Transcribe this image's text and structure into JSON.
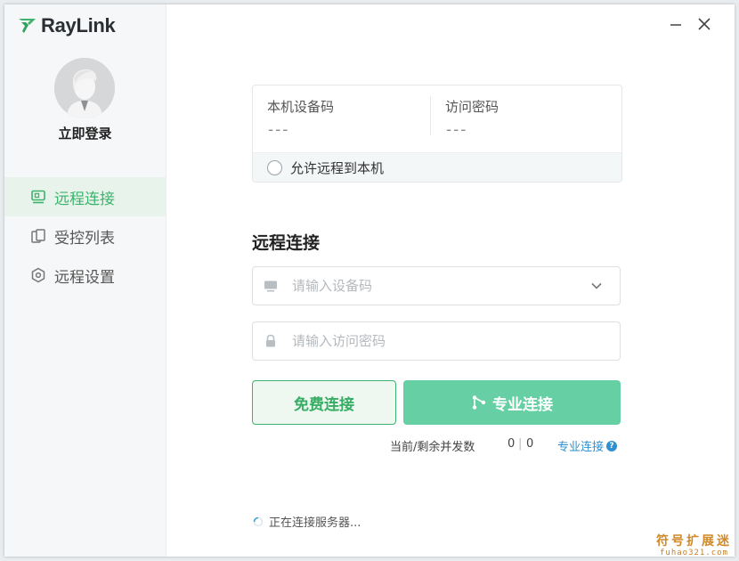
{
  "app": {
    "logo_text": "RayLink"
  },
  "sidebar": {
    "login_label": "立即登录",
    "items": [
      {
        "label": "远程连接",
        "icon": "monitor-icon",
        "active": true
      },
      {
        "label": "受控列表",
        "icon": "devices-icon",
        "active": false
      },
      {
        "label": "远程设置",
        "icon": "hexagon-settings-icon",
        "active": false
      }
    ]
  },
  "card": {
    "device_code_label": "本机设备码",
    "device_code_value": "---",
    "access_password_label": "访问密码",
    "access_password_value": "---",
    "allow_remote_label": "允许远程到本机"
  },
  "connect": {
    "title": "远程连接",
    "device_input_placeholder": "请输入设备码",
    "password_input_placeholder": "请输入访问密码",
    "free_button_label": "免费连接",
    "pro_button_label": "专业连接",
    "concurrency_label": "当前/剩余并发数",
    "concurrency_current": "0",
    "concurrency_remaining": "0",
    "pro_link_label": "专业连接"
  },
  "status": {
    "text": "正在连接服务器..."
  },
  "watermark": {
    "line1": "符号扩展迷",
    "line2": "fuhao321.com"
  },
  "colors": {
    "accent": "#3db36b",
    "pro_button": "#67cfa4",
    "link": "#2f8fcf"
  }
}
